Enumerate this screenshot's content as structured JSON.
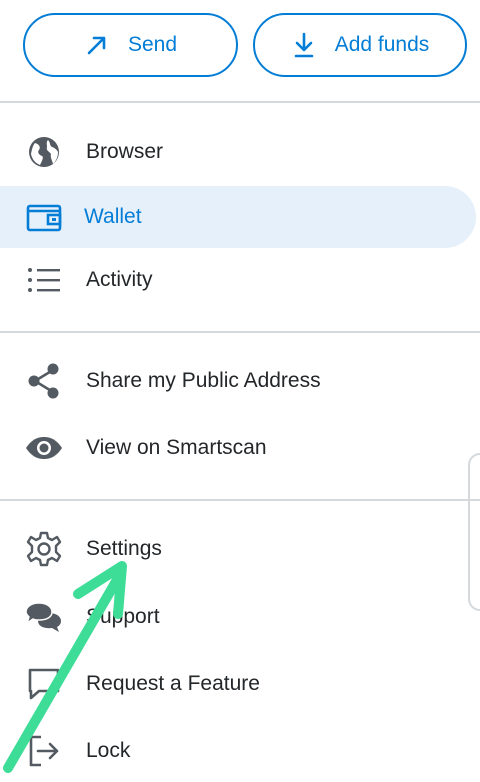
{
  "actions": {
    "send_label": "Send",
    "add_funds_label": "Add funds"
  },
  "menu": {
    "browser": "Browser",
    "wallet": "Wallet",
    "activity": "Activity",
    "share_address": "Share my Public Address",
    "view_smartscan": "View on Smartscan",
    "settings": "Settings",
    "support": "Support",
    "request_feature": "Request a Feature",
    "lock": "Lock"
  },
  "colors": {
    "accent": "#037dd6",
    "active_bg": "#e6f0fa",
    "annotation_arrow": "#3ddc97"
  },
  "icons": {
    "send": "arrow-up-right-icon",
    "add_funds": "download-icon",
    "browser": "globe-icon",
    "wallet": "wallet-icon",
    "activity": "list-icon",
    "share": "share-icon",
    "smartscan": "eye-icon",
    "settings": "gear-icon",
    "support": "chat-bubbles-icon",
    "request": "comment-icon",
    "lock": "logout-icon"
  }
}
